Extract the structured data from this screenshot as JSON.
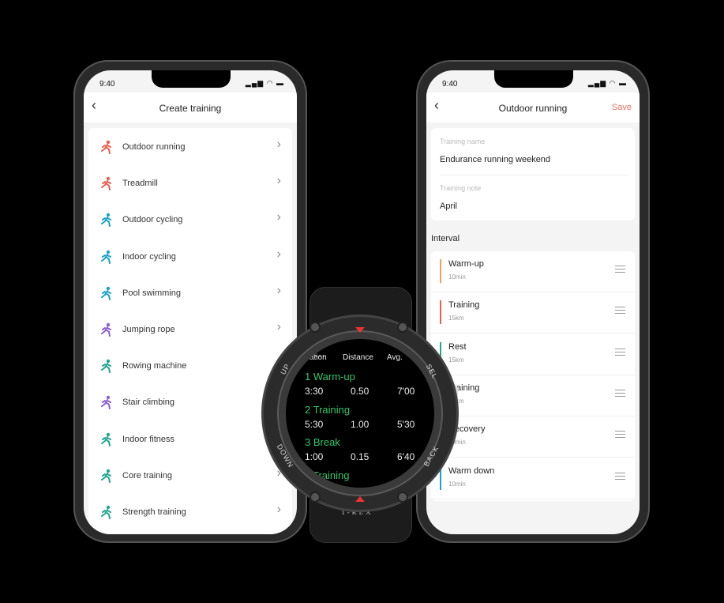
{
  "status": {
    "time": "9:40",
    "icons": "signal wifi battery"
  },
  "left_phone": {
    "title": "Create training",
    "back": "‹",
    "items": [
      {
        "label": "Outdoor running",
        "icon": "running-icon",
        "color": "#e8604c"
      },
      {
        "label": "Treadmill",
        "icon": "treadmill-icon",
        "color": "#e8604c"
      },
      {
        "label": "Outdoor cycling",
        "icon": "cycling-icon",
        "color": "#1aa3c9"
      },
      {
        "label": "Indoor cycling",
        "icon": "indoor-cycling-icon",
        "color": "#1aa3c9"
      },
      {
        "label": "Pool swimming",
        "icon": "swimming-icon",
        "color": "#1aa3c9"
      },
      {
        "label": "Jumping rope",
        "icon": "jump-rope-icon",
        "color": "#8a5fd1"
      },
      {
        "label": "Rowing machine",
        "icon": "rowing-icon",
        "color": "#21a58f"
      },
      {
        "label": "Stair climbing",
        "icon": "stairs-icon",
        "color": "#8a5fd1"
      },
      {
        "label": "Indoor fitness",
        "icon": "fitness-icon",
        "color": "#21a58f"
      },
      {
        "label": "Core training",
        "icon": "core-icon",
        "color": "#21a58f"
      },
      {
        "label": "Strength training",
        "icon": "dumbbell-icon",
        "color": "#21a58f"
      }
    ]
  },
  "right_phone": {
    "title": "Outdoor running",
    "back": "‹",
    "save": "Save",
    "name_label": "Training name",
    "name_value": "Endurance running weekend",
    "note_label": "Training note",
    "note_value": "April",
    "interval_label": "Interval",
    "intervals": [
      {
        "name": "Warm-up",
        "sub": "10min",
        "color": "#f0a060"
      },
      {
        "name": "Training",
        "sub": "15km",
        "color": "#e8604c"
      },
      {
        "name": "Rest",
        "sub": "15km",
        "color": "#21a58f"
      },
      {
        "name": "Training",
        "sub": "15km",
        "color": "#e8604c"
      },
      {
        "name": "Recovery",
        "sub": "10min",
        "color": "#21a58f"
      },
      {
        "name": "Warm down",
        "sub": "10min",
        "color": "#1aa3c9"
      }
    ]
  },
  "watch": {
    "brand": "T-REX",
    "buttons": {
      "up": "UP",
      "down": "DOWN",
      "sel": "SEL",
      "back": "BACK"
    },
    "headers": [
      "ation",
      "Distance",
      "Avg."
    ],
    "rows": [
      {
        "name": "1 Warm-up",
        "dur": "3:30",
        "dist": "0.50",
        "avg": "7'00"
      },
      {
        "name": "2 Training",
        "dur": "5:30",
        "dist": "1.00",
        "avg": "5'30"
      },
      {
        "name": "3 Break",
        "dur": "1:00",
        "dist": "0.15",
        "avg": "6'40"
      }
    ],
    "partial": "Training"
  }
}
